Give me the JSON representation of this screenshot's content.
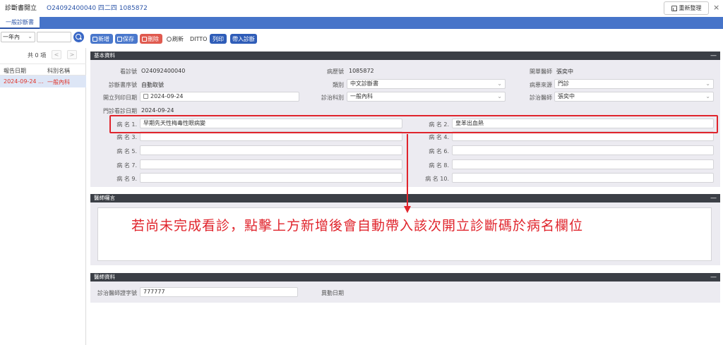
{
  "header": {
    "app_title": "診斷書開立",
    "patient_info": "O24092400040 四二四 1085872",
    "refresh_label": "重新整理",
    "close_label": "×"
  },
  "tabs": [
    {
      "label": "一般診斷書",
      "active": true
    }
  ],
  "filter": {
    "range_value": "一年內",
    "search_value": ""
  },
  "toolbar": {
    "new_label": "新增",
    "save_label": "保存",
    "delete_label": "刪除",
    "reload_label": "刷新",
    "ditto_label": "DITTO",
    "print_label": "列印",
    "bring_label": "帶入診斷"
  },
  "list": {
    "count_text": "共 0 項",
    "prev": "<",
    "next": ">",
    "headers": [
      "報告日期",
      "科別名稱"
    ],
    "rows": [
      {
        "date": "2024-09-24 ...",
        "dept": "一般內科"
      }
    ]
  },
  "basic": {
    "title": "基本資料",
    "collapse": "—",
    "visit_no_label": "看診號",
    "visit_no": "O24092400040",
    "chart_no_label": "病歷號",
    "chart_no": "1085872",
    "attending_label": "開單醫師",
    "attending": "張奕中",
    "cert_no_label": "診斷書序號",
    "cert_no": "自動取號",
    "category_label": "類別",
    "category": "中文診斷書",
    "source_label": "病患來源",
    "source": "門診",
    "print_date_label": "開立列印日期",
    "print_date": "2024-09-24",
    "dept_label": "診治科別",
    "dept": "一般內科",
    "doctor_label": "診治醫師",
    "doctor": "張奕中",
    "visit_date_label": "門診看診日期",
    "visit_date": "2024-09-24",
    "diagnoses": [
      {
        "label": "病 名 1.",
        "value": "早期先天性梅毒性眼病變"
      },
      {
        "label": "病 名 2.",
        "value": "皇苯出血熱"
      },
      {
        "label": "病 名 3.",
        "value": ""
      },
      {
        "label": "病 名 4.",
        "value": ""
      },
      {
        "label": "病 名 5.",
        "value": ""
      },
      {
        "label": "病 名 6.",
        "value": ""
      },
      {
        "label": "病 名 7.",
        "value": ""
      },
      {
        "label": "病 名 8.",
        "value": ""
      },
      {
        "label": "病 名 9.",
        "value": ""
      },
      {
        "label": "病 名 10.",
        "value": ""
      }
    ]
  },
  "notes": {
    "title": "醫師囑言",
    "collapse": "—",
    "value": ""
  },
  "doctor_info": {
    "title": "醫師資料",
    "collapse": "—",
    "license_label": "診治醫師證字號",
    "license_value": "777777",
    "change_date_label": "異動日期",
    "change_date_value": ""
  },
  "annotation": "若尚未完成看診，點擊上方新增後會自動帶入該次開立診斷碼於病名欄位",
  "colors": {
    "primary": "#4674c9",
    "danger": "#e05a4f",
    "annotation": "#e0242c",
    "section_header": "#3b3f46"
  }
}
